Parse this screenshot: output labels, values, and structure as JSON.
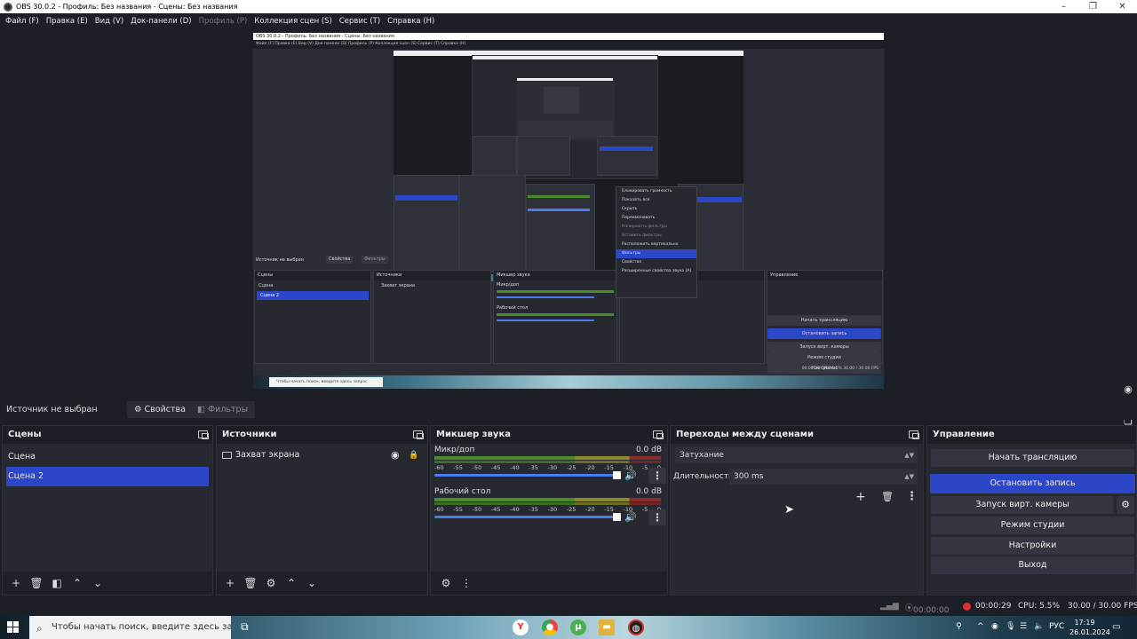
{
  "window": {
    "title": "OBS 30.0.2 - Профиль: Без названия - Сцены: Без названия"
  },
  "menu": [
    {
      "label": "Файл (F)",
      "disabled": false
    },
    {
      "label": "Правка (E)",
      "disabled": false
    },
    {
      "label": "Вид (V)",
      "disabled": false
    },
    {
      "label": "Док-панели (D)",
      "disabled": false
    },
    {
      "label": "Профиль (P)",
      "disabled": true
    },
    {
      "label": "Коллекция сцен (S)",
      "disabled": false
    },
    {
      "label": "Сервис (T)",
      "disabled": false
    },
    {
      "label": "Справка (H)",
      "disabled": false
    }
  ],
  "preview": {
    "inner_title": "OBS 30.0.2 - Профиль: Без названия - Сцены: Без названия",
    "inner_menu": "Файл (F)  Правка (E)  Вид (V)  Док-панели (D)  Профиль (P)  Коллекция сцен (S)  Сервис (T)  Справка (H)",
    "context_menu": [
      "Блокировать громкость",
      "Показать все",
      "Скрыть",
      "Переименовать",
      "Копировать фильтры",
      "Вставить фильтры",
      "Расположить вертикально",
      "Фильтры",
      "Свойства",
      "Расширенные свойства звука (A)"
    ],
    "context_highlight": "Фильтры",
    "inner_src_bar": "Источник не выбран",
    "inner_props": "Свойства",
    "inner_filters": "Фильтры",
    "inner_docks": {
      "scenes": "Сцены",
      "sources": "Источники",
      "mixer": "Микшер звука",
      "controls": "Управление"
    },
    "inner_scene_items": [
      "Сцена",
      "Сцена 2"
    ],
    "inner_source": "Захват экрана",
    "inner_mic": "Микр/доп",
    "inner_desktop": "Рабочий стол",
    "inner_db": "0.0 dB",
    "inner_buttons": [
      "Начать трансляцию",
      "Остановить запись",
      "Запуск вирт. камеры",
      "Режим студии",
      "Настройки",
      "Выход"
    ],
    "inner_status": "00:00:29   CPU: 5.5%   30.00 / 30.00 FPS",
    "inner_search": "Чтобы начать поиск, введите здесь запрос"
  },
  "source_bar": {
    "label": "Источник не выбран",
    "properties": "Свойства",
    "filters": "Фильтры"
  },
  "scenes": {
    "title": "Сцены",
    "items": [
      "Сцена",
      "Сцена 2"
    ],
    "selected": "Сцена 2"
  },
  "sources": {
    "title": "Источники",
    "items": [
      {
        "label": "Захват экрана",
        "visible": true,
        "locked": true
      }
    ]
  },
  "mixer": {
    "title": "Микшер звука",
    "channels": [
      {
        "name": "Микр/доп",
        "db": "0.0 dB",
        "volume_pct": 100
      },
      {
        "name": "Рабочий стол",
        "db": "0.0 dB",
        "volume_pct": 100
      }
    ],
    "ticks": [
      "-60",
      "-55",
      "-50",
      "-45",
      "-40",
      "-35",
      "-30",
      "-25",
      "-20",
      "-15",
      "-10",
      "-5",
      "0"
    ]
  },
  "transitions": {
    "title": "Переходы между сценами",
    "transition": "Затухание",
    "duration_label": "Длительность",
    "duration": "300 ms"
  },
  "controls": {
    "title": "Управление",
    "start_stream": "Начать трансляцию",
    "stop_record": "Остановить запись",
    "virtual_cam": "Запуск вирт. камеры",
    "studio_mode": "Режим студии",
    "settings": "Настройки",
    "exit": "Выход"
  },
  "status": {
    "stream_time": "00:00:00",
    "rec_time": "00:00:29",
    "cpu": "CPU: 5.5%",
    "fps": "30.00 / 30.00 FPS"
  },
  "taskbar": {
    "search_placeholder": "Чтобы начать поиск, введите здесь запрос",
    "lang": "РУС",
    "time": "17:19",
    "date": "26.01.2024"
  },
  "colors": {
    "accent": "#2c46c8",
    "bg": "#1d1f26",
    "panel": "#272930",
    "record": "#e03030"
  }
}
